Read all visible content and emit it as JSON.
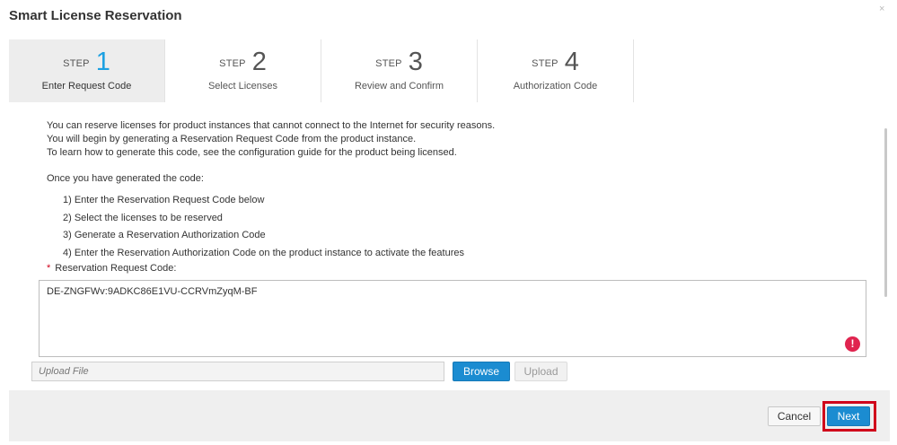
{
  "dialog": {
    "title": "Smart License Reservation",
    "close_glyph": "×"
  },
  "steps": [
    {
      "word": "STEP",
      "number": "1",
      "label": "Enter Request Code",
      "active": true
    },
    {
      "word": "STEP",
      "number": "2",
      "label": "Select Licenses",
      "active": false
    },
    {
      "word": "STEP",
      "number": "3",
      "label": "Review and Confirm",
      "active": false
    },
    {
      "word": "STEP",
      "number": "4",
      "label": "Authorization Code",
      "active": false
    }
  ],
  "intro": [
    "You can reserve licenses for product instances that cannot connect to the Internet for security reasons.",
    "You will begin by generating a Reservation Request Code from the product instance.",
    "To learn how to generate this code, see the configuration guide for the product being licensed."
  ],
  "once_text": "Once you have generated the code:",
  "instructions": [
    "1) Enter the Reservation Request Code below",
    "2) Select the licenses to be reserved",
    "3) Generate a Reservation Authorization Code",
    "4) Enter the Reservation Authorization Code on the product instance to activate the features"
  ],
  "request_code": {
    "required_marker": "*",
    "label": "Reservation Request Code:",
    "value": "DE-ZNGFWv:9ADKC86E1VU-CCRVmZyqM-BF",
    "error_glyph": "!"
  },
  "upload": {
    "placeholder": "Upload File",
    "browse_label": "Browse",
    "upload_label": "Upload"
  },
  "footer": {
    "cancel_label": "Cancel",
    "next_label": "Next"
  },
  "colors": {
    "accent": "#1ba0e2",
    "primary_button": "#1b8cd1",
    "error": "#e0244f",
    "highlight": "#d0021b"
  },
  "icons": {
    "close": "close-icon",
    "error": "error-icon"
  }
}
